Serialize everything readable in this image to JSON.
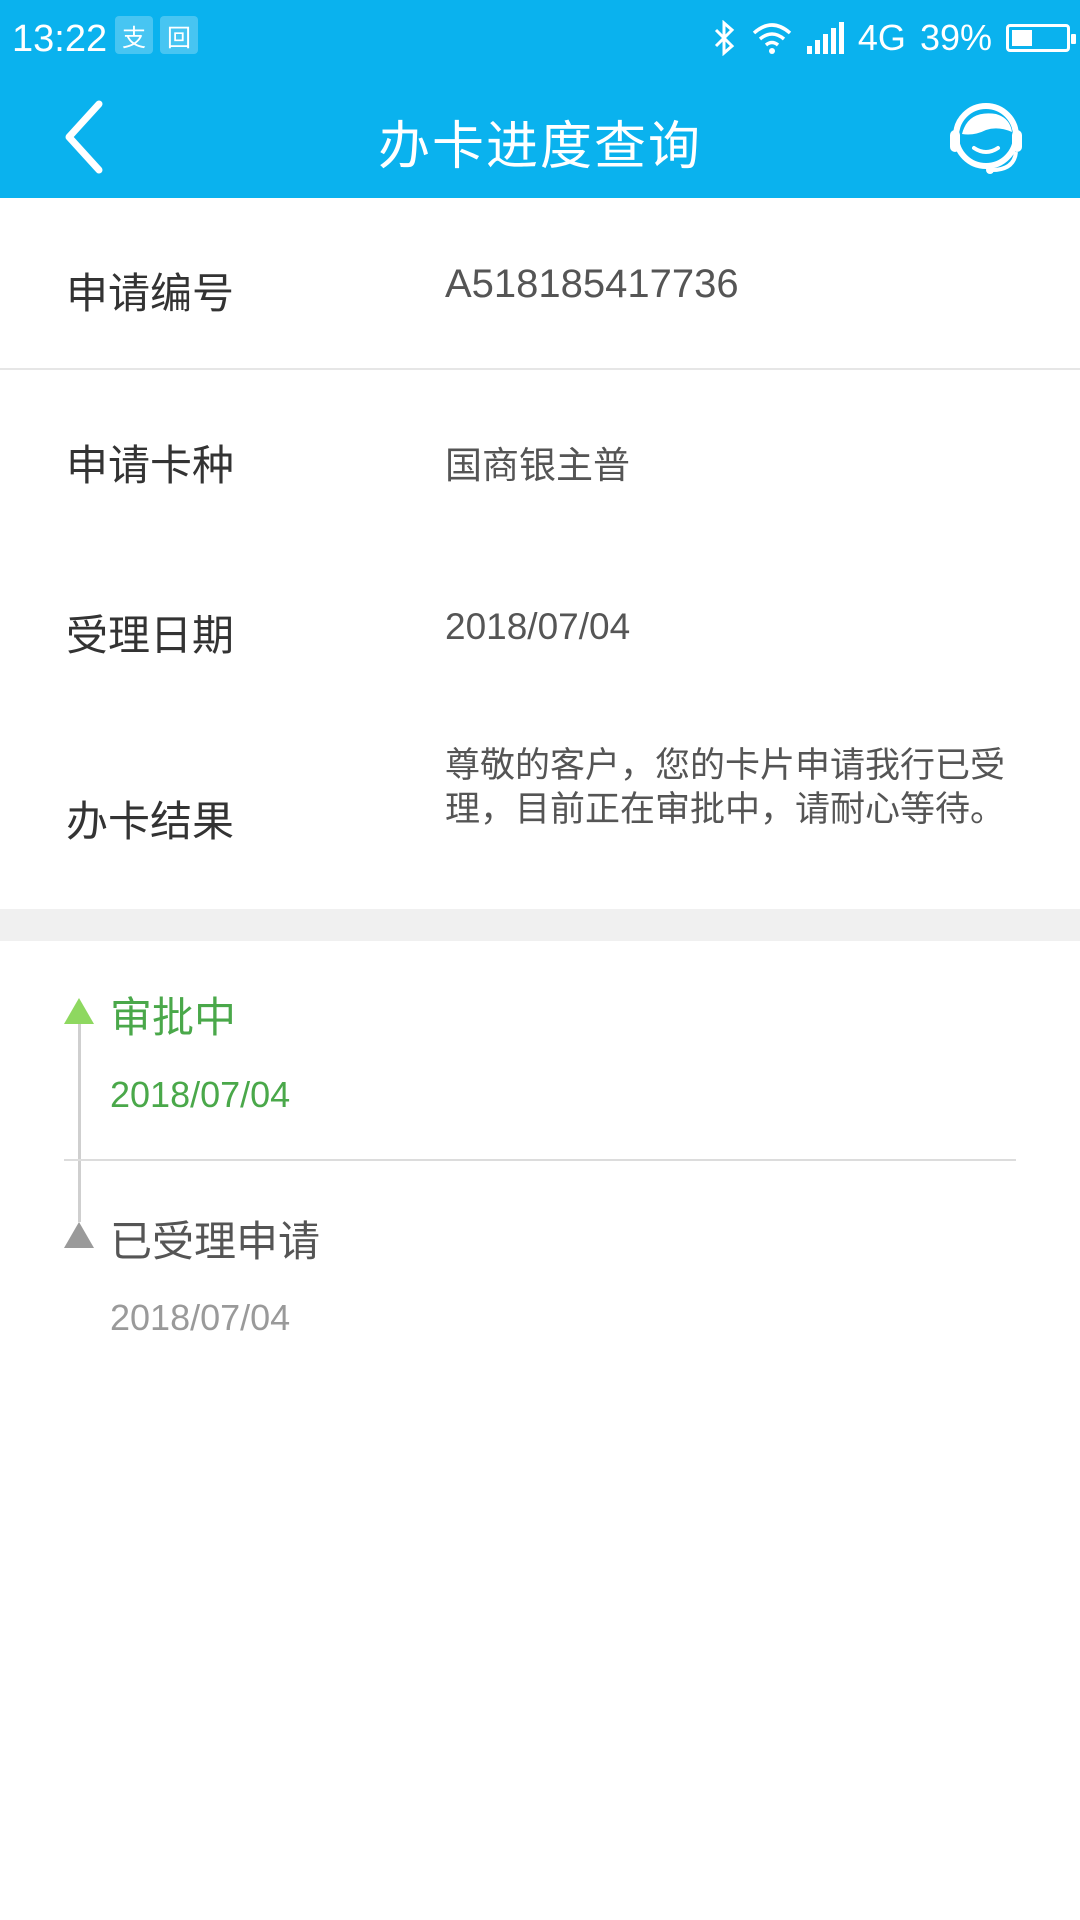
{
  "status_bar": {
    "time": "13:22",
    "app_badge_1": "支",
    "app_badge_2": "回",
    "network": "4G",
    "battery_percent": "39%",
    "battery_level": 0.39
  },
  "nav": {
    "title": "办卡进度查询",
    "back_icon": "chevron-left-icon",
    "service_icon": "customer-service-icon"
  },
  "details": {
    "application_no_label": "申请编号",
    "application_no_value": "A518185417736",
    "card_type_label": "申请卡种",
    "card_type_value": "国商银主普",
    "accept_date_label": "受理日期",
    "accept_date_value": "2018/07/04",
    "result_label": "办卡结果",
    "result_value": "尊敬的客户，您的卡片申请我行已受理，目前正在审批中，请耐心等待。"
  },
  "timeline": [
    {
      "title": "审批中",
      "date": "2018/07/04",
      "active": true
    },
    {
      "title": "已受理申请",
      "date": "2018/07/04",
      "active": false
    }
  ],
  "colors": {
    "header": "#0ab2ee",
    "active_green": "#4aa84a",
    "active_triangle": "#8ed860",
    "inactive_gray": "#9a9a9a"
  }
}
